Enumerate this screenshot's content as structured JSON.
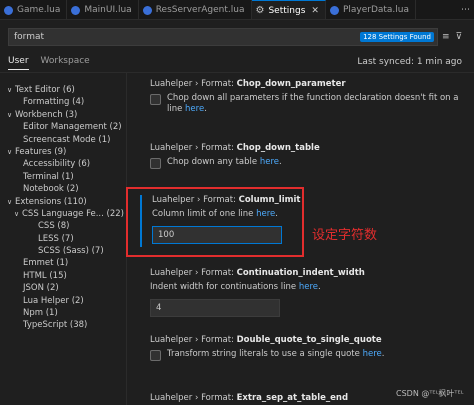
{
  "tabs": [
    {
      "label": "Game.lua",
      "active": false
    },
    {
      "label": "MainUI.lua",
      "active": false
    },
    {
      "label": "ResServerAgent.lua",
      "active": false
    },
    {
      "label": "Settings",
      "active": true
    },
    {
      "label": "PlayerData.lua",
      "active": false
    }
  ],
  "search": {
    "value": "format",
    "count": "128 Settings Found"
  },
  "scope": {
    "user": "User",
    "workspace": "Workspace",
    "last_synced": "Last synced: 1 min ago"
  },
  "toc": [
    {
      "label": "Text Editor (6)",
      "indent": 1,
      "chevron": "down"
    },
    {
      "label": "Formatting (4)",
      "indent": 2,
      "chevron": ""
    },
    {
      "label": "Workbench (3)",
      "indent": 1,
      "chevron": "down"
    },
    {
      "label": "Editor Management (2)",
      "indent": 2,
      "chevron": ""
    },
    {
      "label": "Screencast Mode (1)",
      "indent": 2,
      "chevron": ""
    },
    {
      "label": "Features (9)",
      "indent": 1,
      "chevron": "down"
    },
    {
      "label": "Accessibility (6)",
      "indent": 2,
      "chevron": ""
    },
    {
      "label": "Terminal (1)",
      "indent": 2,
      "chevron": ""
    },
    {
      "label": "Notebook (2)",
      "indent": 2,
      "chevron": ""
    },
    {
      "label": "Extensions (110)",
      "indent": 1,
      "chevron": "down"
    },
    {
      "label": "CSS Language Fe... (22)",
      "indent": 2,
      "chevron": "down"
    },
    {
      "label": "CSS (8)",
      "indent": 3,
      "chevron": ""
    },
    {
      "label": "LESS (7)",
      "indent": 3,
      "chevron": ""
    },
    {
      "label": "SCSS (Sass) (7)",
      "indent": 3,
      "chevron": ""
    },
    {
      "label": "Emmet (1)",
      "indent": 2,
      "chevron": ""
    },
    {
      "label": "HTML (15)",
      "indent": 2,
      "chevron": ""
    },
    {
      "label": "JSON (2)",
      "indent": 2,
      "chevron": ""
    },
    {
      "label": "Lua Helper (2)",
      "indent": 2,
      "chevron": ""
    },
    {
      "label": "Npm (1)",
      "indent": 2,
      "chevron": ""
    },
    {
      "label": "TypeScript (38)",
      "indent": 2,
      "chevron": ""
    }
  ],
  "settings": [
    {
      "prefix": "Luahelper › Format: ",
      "name": "Chop_down_parameter",
      "type": "checkbox",
      "desc": "Chop down all parameters if the function declaration doesn't fit on a line",
      "link": "here",
      "link_suffix": "."
    },
    {
      "prefix": "Luahelper › Format: ",
      "name": "Chop_down_table",
      "type": "checkbox",
      "desc": "Chop down any table ",
      "link": "here",
      "link_suffix": "."
    },
    {
      "prefix": "Luahelper › Format: ",
      "name": "Column_limit",
      "type": "number",
      "desc": "Column limit of one line ",
      "link": "here",
      "link_suffix": ".",
      "value": "100"
    },
    {
      "prefix": "Luahelper › Format: ",
      "name": "Continuation_indent_width",
      "type": "number",
      "desc": "Indent width for continuations line ",
      "link": "here",
      "link_suffix": ".",
      "value": "4"
    },
    {
      "prefix": "Luahelper › Format: ",
      "name": "Double_quote_to_single_quote",
      "type": "checkbox",
      "desc": "Transform string literals to use a single quote ",
      "link": "here",
      "link_suffix": "."
    },
    {
      "prefix": "Luahelper › Format: ",
      "name": "Extra_sep_at_table_end",
      "type": "checkbox",
      "desc": "",
      "link": "",
      "link_suffix": ""
    }
  ],
  "annotation": {
    "text": "设定字符数",
    "color": "#e22d2d"
  },
  "watermark": "CSDN @ᵀᴱᴸ枫叶ᵀᴱᴸ",
  "colors": {
    "accent": "#0078d4",
    "link": "#4daafc",
    "background": "#1f1f1f"
  }
}
